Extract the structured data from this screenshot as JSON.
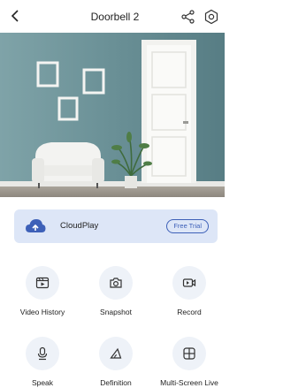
{
  "header": {
    "title": "Doorbell 2"
  },
  "cloud": {
    "label": "CloudPlay",
    "trial_label": "Free Trial"
  },
  "actions": [
    {
      "label": "Video History",
      "icon": "video-history-icon"
    },
    {
      "label": "Snapshot",
      "icon": "camera-icon"
    },
    {
      "label": "Record",
      "icon": "record-icon"
    },
    {
      "label": "Speak",
      "icon": "microphone-icon"
    },
    {
      "label": "Definition",
      "icon": "definition-icon"
    },
    {
      "label": "Multi-Screen Live",
      "icon": "multi-screen-icon"
    }
  ],
  "colors": {
    "accent": "#3d60b8",
    "card_bg": "#dde6f7",
    "wall": "#6b9197"
  }
}
